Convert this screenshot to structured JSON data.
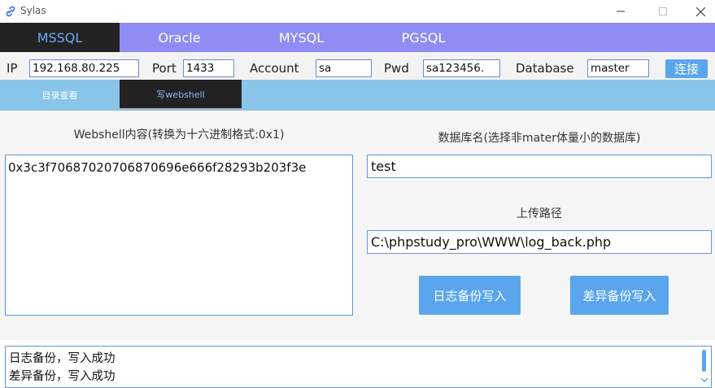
{
  "window": {
    "title": "Sylas",
    "app_icon": "link-icon",
    "controls": {
      "minimize": "—",
      "maximize": "☐",
      "close": "✕"
    }
  },
  "db_tabs": [
    "MSSQL",
    "Oracle",
    "MYSQL",
    "PGSQL"
  ],
  "db_tabs_active": "MSSQL",
  "connection": {
    "ip_label": "IP",
    "ip_value": "192.168.80.225",
    "port_label": "Port",
    "port_value": "1433",
    "account_label": "Account",
    "account_value": "sa",
    "pwd_label": "Pwd",
    "pwd_value": "sa123456.",
    "database_label": "Database",
    "database_value": "master",
    "connect_label": "连接"
  },
  "func_tabs": [
    "目录查看",
    "写webshell"
  ],
  "func_tabs_active": "写webshell",
  "main": {
    "webshell_label": "Webshell内容(转换为十六进制格式:0x1)",
    "webshell_value": "0x3c3f70687020706870696e666f28293b203f3e",
    "dbname_label": "数据库名(选择非mater体量小的数据库)",
    "dbname_value": "test",
    "path_label": "上传路径",
    "path_value": "C:\\phpstudy_pro\\WWW\\log_back.php",
    "log_backup_btn": "日志备份写入",
    "diff_backup_btn": "差异备份写入"
  },
  "log": {
    "lines": [
      "日志备份，写入成功",
      "差异备份，写入成功"
    ]
  },
  "colors": {
    "tab_bar": "#8f8cf3",
    "active_tab_bg": "#222222",
    "active_tab_text": "#6eaaf5",
    "func_bar": "#88c5e9",
    "accent_button": "#5aa6ee",
    "input_border": "#5f97d8"
  }
}
